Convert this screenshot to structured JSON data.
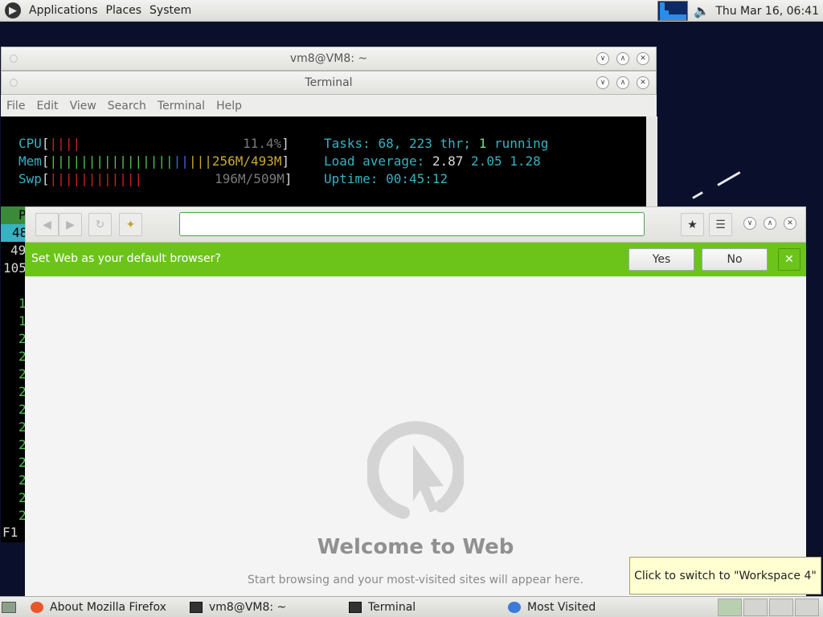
{
  "top_panel": {
    "menus": [
      "Applications",
      "Places",
      "System"
    ],
    "clock": "Thu Mar 16, 06:41"
  },
  "windows": {
    "back_title": "vm8@VM8: ~",
    "terminal_title": "Terminal"
  },
  "terminal": {
    "menus": [
      "File",
      "Edit",
      "View",
      "Search",
      "Terminal",
      "Help"
    ],
    "htop": {
      "cpu_label": "CPU",
      "cpu_bar": "||||",
      "cpu_value": "11.4%",
      "mem_label": "Mem",
      "mem_bar_green": "||||||||||||||||",
      "mem_bar_blue": "||",
      "mem_bar_yellow": "|||",
      "mem_value": "256M/493M",
      "swp_label": "Swp",
      "swp_bar": "||||||||||||",
      "swp_value": "196M/509M",
      "tasks_label": "Tasks:",
      "tasks_value": "68,",
      "thr_value": "223",
      "thr_label": "thr;",
      "running_value": "1",
      "running_label": "running",
      "load_label": "Load average:",
      "load1": "2.87",
      "load2": "2.05",
      "load3": "1.28",
      "uptime_label": "Uptime:",
      "uptime_value": "00:45:12",
      "row_header_char": "P",
      "row_pids": [
        "48",
        "49",
        "105"
      ],
      "list_chars": [
        "1",
        "1",
        "2",
        "2",
        "2",
        "2",
        "2",
        "2",
        "2",
        "2",
        "2",
        "2",
        "2"
      ],
      "footer": "F1"
    }
  },
  "web": {
    "url_placeholder": "",
    "infobar_message": "Set Web as your default browser?",
    "yes_label": "Yes",
    "no_label": "No",
    "welcome_title": "Welcome to Web",
    "welcome_subtitle": "Start browsing and your most-visited sites will appear here."
  },
  "tooltip": "Click to switch to \"Workspace 4\"",
  "taskbar": {
    "tasks": [
      "About Mozilla Firefox",
      "vm8@VM8: ~",
      "Terminal",
      "Most Visited"
    ]
  },
  "colors": {
    "infobar": "#6cc41a",
    "desktop": "#0a0f2c",
    "terminal_bg": "#000000"
  }
}
